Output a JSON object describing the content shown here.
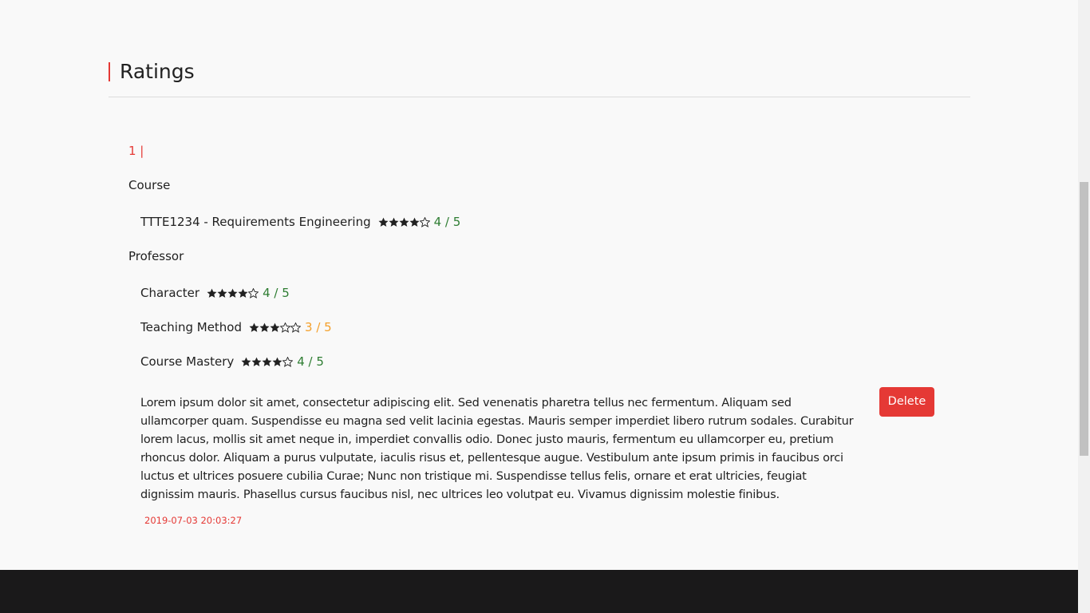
{
  "header": {
    "title": "Ratings"
  },
  "rating": {
    "index_label": "1 |",
    "course_section_label": "Course",
    "course": {
      "label": "TTTE1234 - Requirements Engineering",
      "stars": 4,
      "max": 5,
      "score_text": "4 / 5",
      "score_color": "#2e7d32"
    },
    "professor_section_label": "Professor",
    "professor": [
      {
        "label": "Character",
        "stars": 4,
        "max": 5,
        "score_text": "4 / 5",
        "score_color": "#2e7d32"
      },
      {
        "label": "Teaching Method",
        "stars": 3,
        "max": 5,
        "score_text": "3 / 5",
        "score_color": "#f4a02b"
      },
      {
        "label": "Course Mastery",
        "stars": 4,
        "max": 5,
        "score_text": "4 / 5",
        "score_color": "#2e7d32"
      }
    ],
    "comment": "Lorem ipsum dolor sit amet, consectetur adipiscing elit. Sed venenatis pharetra tellus nec fermentum. Aliquam sed ullamcorper quam. Suspendisse eu magna sed velit lacinia egestas. Mauris semper imperdiet libero rutrum sodales. Curabitur lorem lacus, mollis sit amet neque in, imperdiet convallis odio. Donec justo mauris, fermentum eu ullamcorper eu, pretium rhoncus dolor. Aliquam a purus vulputate, iaculis risus et, pellentesque augue. Vestibulum ante ipsum primis in faucibus orci luctus et ultrices posuere cubilia Curae; Nunc non tristique mi. Suspendisse tellus felis, ornare et erat ultricies, feugiat dignissim mauris. Phasellus cursus faucibus nisl, nec ultrices leo volutpat eu. Vivamus dignissim molestie finibus.",
    "timestamp": "2019-07-03 20:03:27",
    "delete_label": "Delete"
  },
  "colors": {
    "accent_red": "#e53935",
    "score_green": "#2e7d32",
    "score_orange": "#f4a02b",
    "footer_bg": "#1a191a"
  },
  "icons": {
    "filled_star": "star-filled-icon",
    "empty_star": "star-empty-icon"
  }
}
